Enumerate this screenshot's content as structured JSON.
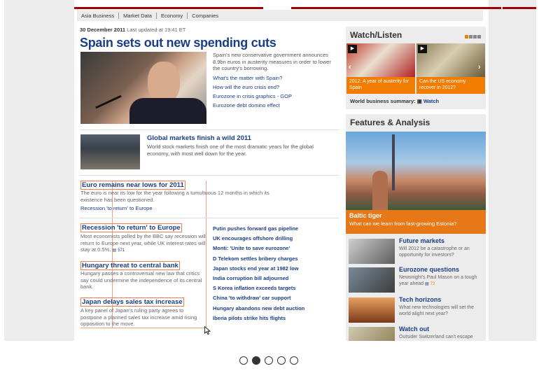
{
  "nav": [
    "Asia Business",
    "Market Data",
    "Economy",
    "Companies"
  ],
  "dateline": {
    "date": "30 December 2011",
    "updated": "Last updated at 19:41 ET"
  },
  "headline": "Spain sets out new spending cuts",
  "lead": {
    "text": "Spain's new conservative government announces 8.9bn euros in austerity measures in order to lower the country's borrowing.",
    "links": [
      "What's the matter with Spain?",
      "How will the euro crisis end?",
      "Eurozone in crisis graphics - GOP",
      "Eurozone debt domino effect"
    ]
  },
  "global": {
    "title": "Global markets finish a wild 2011",
    "text": "World stock markets finish one of the most dramatic years for the global economy, with most well down for the year."
  },
  "stories": [
    {
      "title": "Euro remains near lows for 2011",
      "text": "The euro is near its low for the year following a tumultuous 12 months in which its existence has been questioned.",
      "link": "Recession 'to return' to Europe"
    },
    {
      "title": "Recession 'to return' to Europe",
      "text": "Most economists polled by the BBC say recession will return to Europe next year, while UK interest rates will stay at 0.5%.",
      "comments": "571"
    },
    {
      "title": "Hungary threat to central bank",
      "text": "Hungary passes a controversial new law that critics say could undermine the independence of its central bank."
    },
    {
      "title": "Japan delays sales tax increase",
      "text": "A key panel of Japan's ruling party agrees to postpone a planned sales tax increase amid rising opposition to the move."
    }
  ],
  "headlines": [
    "Putin pushes forward gas pipeline",
    "UK encourages offshore drilling",
    "Monti: 'Unite to save eurozone'",
    "D Telekom settles bribery charges",
    "Japan stocks end year at 1982 low",
    "India corruption bill adjourned",
    "S Korea inflation exceeds targets",
    "China 'to withdraw' car support",
    "Hungary abandons new debt auction",
    "Iberia pilots strike hits flights"
  ],
  "watch": {
    "title": "Watch/Listen",
    "videos": [
      {
        "caption": "2012: A year of austerity for Spain"
      },
      {
        "caption": "Can the US economy recover in 2012?"
      }
    ],
    "summary_label": "World business summary:",
    "summary_link": "Watch"
  },
  "features": {
    "title": "Features & Analysis",
    "main": {
      "title": "Baltic tiger",
      "desc": "What can we learn from fast-growing Estonia?"
    },
    "items": [
      {
        "title": "Future markets",
        "desc": "Will 2012 be a catastrophe or an opportunity for investors?"
      },
      {
        "title": "Eurozone questions",
        "desc": "Newsnight's Paul Mason on a tough year ahead",
        "comments": "72"
      },
      {
        "title": "Tech horizons",
        "desc": "What new technologies will set the world alight next year?"
      },
      {
        "title": "Watch out",
        "desc": "Outsider Switzerland can't escape"
      }
    ]
  },
  "colors": {
    "link": "#1a3e85",
    "accent": "#f27c00",
    "brand_red": "#a00000"
  },
  "carousel": {
    "count": 5,
    "active_index": 1
  }
}
